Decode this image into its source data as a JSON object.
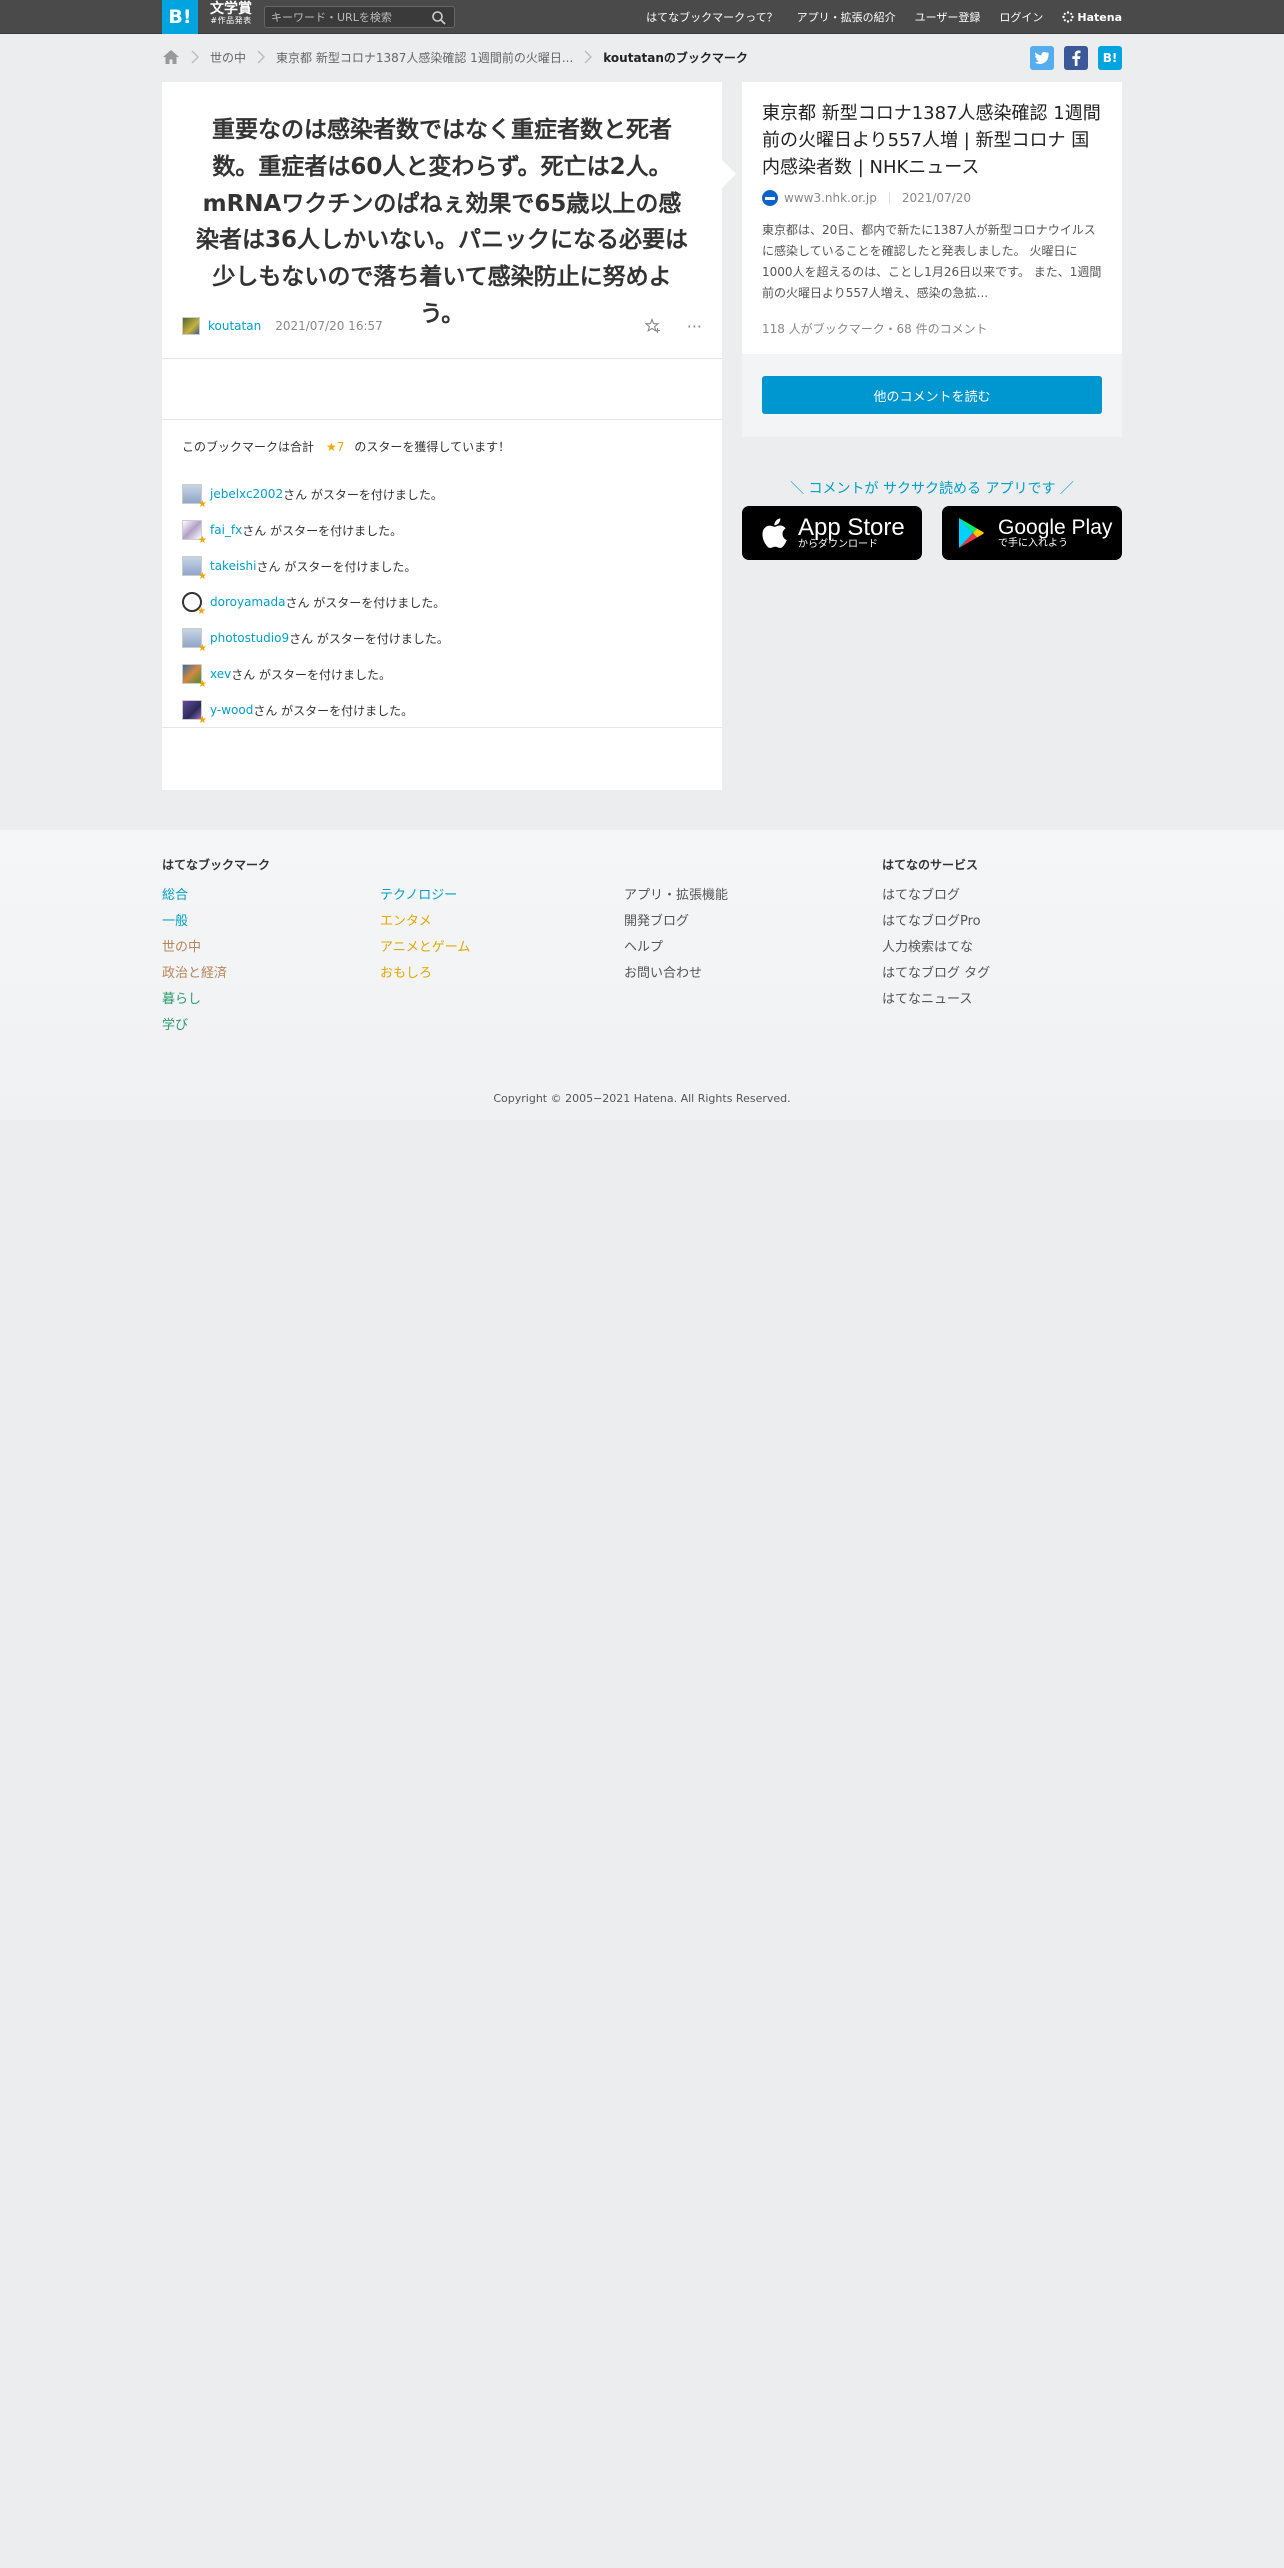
{
  "header": {
    "logo": "B!",
    "award_main": "文学賞",
    "award_sub": "#作品発表",
    "search_placeholder": "キーワード・URLを検索",
    "nav": [
      "はてなブックマークって？",
      "アプリ・拡張の紹介",
      "ユーザー登録",
      "ログイン"
    ],
    "brand": "Hatena"
  },
  "breadcrumb": {
    "items": [
      "世の中",
      "東京都 新型コロナ1387人感染確認 1週間前の火曜日...",
      "koutatanのブックマーク"
    ]
  },
  "share": {
    "twitter": "t",
    "facebook": "f",
    "hatena": "B!"
  },
  "bookmark": {
    "comment": "重要なのは感染者数ではなく重症者数と死者数。重症者は60人と変わらず。死亡は2人。mRNAワクチンのぱねぇ効果で65歳以上の感染者は36人しかいない。パニックになる必要は少しもないので落ち着いて感染防止に努めよう。",
    "user": "koutatan",
    "date": "2021/07/20 16:57",
    "more": "···",
    "stars_prefix": "このブックマークは合計",
    "stars_total": "★7",
    "stars_suffix": "のスターを獲得しています！",
    "star_suffix": "さん がスターを付けました。",
    "stars": [
      {
        "user": "jebelxc2002"
      },
      {
        "user": "fai_fx"
      },
      {
        "user": "takeishi"
      },
      {
        "user": "doroyamada"
      },
      {
        "user": "photostudio9"
      },
      {
        "user": "xev"
      },
      {
        "user": "y-wood"
      }
    ]
  },
  "entry": {
    "title": "東京都 新型コロナ1387人感染確認 1週間前の火曜日より557人増 | 新型コロナ 国内感染者数 | NHKニュース",
    "domain": "www3.nhk.or.jp",
    "date": "2021/07/20",
    "summary": "東京都は、20日、都内で新たに1387人が新型コロナウイルスに感染していることを確認したと発表しました。 火曜日に1000人を超えるのは、ことし1月26日以来です。 また、1週間前の火曜日より557人増え、感染の急拡...",
    "counts": "118 人がブックマーク・68 件のコメント",
    "read_button": "他のコメントを読む"
  },
  "app": {
    "promo": "＼ コメントが サクサク読める アプリです ／",
    "appstore_big": "App Store",
    "appstore_small": "からダウンロード",
    "googleplay_big": "Google Play",
    "googleplay_small": "で手に入れよう"
  },
  "footer": {
    "title_bookmark": "はてなブックマーク",
    "cat_col1": [
      "総合",
      "一般",
      "世の中",
      "政治と経済",
      "暮らし",
      "学び"
    ],
    "cat_col2": [
      "テクノロジー",
      "エンタメ",
      "アニメとゲーム",
      "おもしろ"
    ],
    "links": [
      "アプリ・拡張機能",
      "開発ブログ",
      "ヘルプ",
      "お問い合わせ"
    ],
    "title_services": "はてなのサービス",
    "services": [
      "はてなブログ",
      "はてなブログPro",
      "人力検索はてな",
      "はてなブログ タグ",
      "はてなニュース"
    ],
    "copyright": "Copyright © 2005−2021 Hatena. All Rights Reserved."
  },
  "colors": {
    "accent": "#00a4de",
    "link": "#00a0c6",
    "star": "#f0a700",
    "cat_col1": [
      "#00a0c6",
      "#00a0c6",
      "#b8865a",
      "#b8865a",
      "#2c9a6a",
      "#2c9a6a"
    ],
    "cat_col2": [
      "#00a0c6",
      "#e0a800",
      "#e0a800",
      "#e0a800"
    ]
  }
}
